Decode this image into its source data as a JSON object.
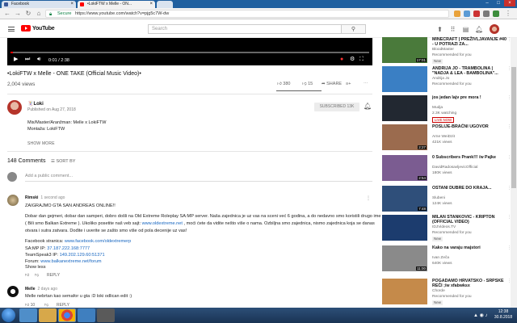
{
  "browser": {
    "tabs": [
      {
        "title": "Facebook",
        "active": false,
        "icon_color": "#3b5998"
      },
      {
        "title": "•LokiFTW x Melle - ON...",
        "active": true,
        "icon_color": "#ff0000"
      },
      {
        "title": "",
        "active": false,
        "icon_color": "#dddddd"
      }
    ],
    "secure_label": "Secure",
    "url": "https://www.youtube.com/watch?v=pjg5c7W-dw"
  },
  "youtube": {
    "logo": "YouTube",
    "search_placeholder": "Search",
    "header_icons": [
      "upload-icon",
      "apps-icon",
      "messages-icon",
      "notifications-icon",
      "account-avatar"
    ]
  },
  "player": {
    "time": "0:01 / 2:38",
    "progress_fraction": 0.006
  },
  "video": {
    "title": "•LokiFTW x Melle - ONE TAKE (Official Music Video)•",
    "views": "2,004 views",
    "likes": "380",
    "dislikes": "15",
    "like_ratio": 0.96,
    "share_label": "SHARE"
  },
  "channel": {
    "name": "🃏Loki",
    "published": "Published on Aug 27, 2018",
    "subscribe_label": "SUBSCRIBED  13K",
    "description": [
      "Mix/Master/Aranžman: Melle x LokiFTW",
      "Montaža: LokiFTW"
    ],
    "show_more": "SHOW MORE"
  },
  "comments": {
    "count": "148 Comments",
    "sort_label": "SORT BY",
    "add_placeholder": "Add a public comment...",
    "items": [
      {
        "author": "Rimski",
        "time": "1 second ago",
        "lines": [
          "ZAIGRAJMO GTA SAN ANDREAS ONLINE!!",
          "",
          "Dobar dan gejmeri, dobar dan samperi, dobro došli na Old Extreme Roleplay SA:MP server. Naša zajednica je uz vas na sceni već 6 godina, a do nedavno smo koristili drugo ime",
          "( Bili smo Balkan Extreme ). Ukoliko posetite naš veb sajt: www.oldextreme.net , moći ćete da vidite nešto više o nama. Ozbiljna smo zajednica, nismo zajednica koja se danas",
          "otvara i sutra zatvara. Dođite i uverite se zašto smo više od pola decenije uz vas!",
          "",
          "Facebook stranica: www.facebook.com/oldextremerp",
          "SA:MP IP: 37.187.222.168:7777",
          "TeamSpeak3 IP: 149.202.129.60:51371",
          "Forum: www.balkanextreme.net/forum"
        ],
        "show_less": "Show less",
        "likes": "",
        "reply": "REPLY"
      },
      {
        "author": "Melle",
        "time": "2 days ago",
        "lines": [
          "Melle nebrtan kao semafor u gta :D loki odlican edit :)"
        ],
        "likes": "10",
        "reply": "REPLY"
      }
    ]
  },
  "sidebar": [
    {
      "title": "MINECRAFT | PREŽIVLJAVANJE #40 - U POTRAZI ZA...",
      "channel": "BloodMaster",
      "meta": "Recommended for you",
      "badge": "New",
      "duration": "17:01",
      "thumb": "#4a7a3b"
    },
    {
      "title": "ANDRIJA JO - TRAMBOLINA | \"NADJA & LEA - BAMBOLINA\"...",
      "channel": "Andrija Jo",
      "meta": "Recommended for you",
      "badge": "",
      "duration": "",
      "thumb": "#3a7fc4"
    },
    {
      "title": "jos jedan lajv pre mora !",
      "channel": "Mudja",
      "meta": "2.3K watching",
      "badge": "LIVE NOW",
      "duration": "",
      "thumb": "#222831"
    },
    {
      "title": "POSLIJE-BRAĆNI UGOVOR",
      "channel": "Arne WeiDzit",
      "meta": "421K views",
      "badge": "",
      "duration": "2:27",
      "thumb": "#9b6b4e"
    },
    {
      "title": "0 Subscribers Prank!!! /w Pajke",
      "channel": "DavidRadosavljevicOfficial",
      "meta": "180K views",
      "badge": "",
      "duration": "2:54",
      "thumb": "#7b5c91"
    },
    {
      "title": "OSTANI DUBRE DO KRAJA...",
      "channel": "Slubeni",
      "meta": "124K views",
      "badge": "",
      "duration": "7:48",
      "thumb": "#2f4f7a"
    },
    {
      "title": "MILAN STANKOVIC - KRIPTON (OFFICIAL VIDEO)",
      "channel": "IDJVideos.TV",
      "meta": "Recommended for you",
      "badge": "New",
      "duration": "",
      "thumb": "#1c3c6e"
    },
    {
      "title": "Kako na varaju majstori",
      "channel": "Ivan Zeča",
      "meta": "640K views",
      "badge": "",
      "duration": "11:00",
      "thumb": "#8a8a8a"
    },
    {
      "title": "POGADAMO HRVATSKO - SRPSKE REČI ;/w xfabwksx",
      "channel": "Chorde",
      "meta": "Recommended for you",
      "badge": "New",
      "duration": "",
      "thumb": "#c58a4a"
    }
  ],
  "taskbar": {
    "time": "12:38",
    "date": "30.8.2018"
  }
}
